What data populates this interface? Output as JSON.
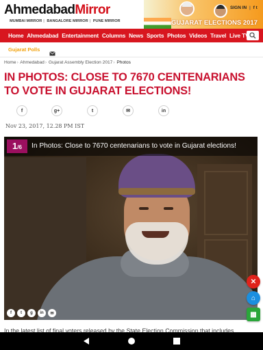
{
  "header": {
    "logo_part1": "Ahmedabad",
    "logo_part2": "Mirror",
    "sister_links": [
      "MUMBAI MIRROR",
      "BANGALORE MIRROR",
      "PUNE MIRROR"
    ],
    "banner_title": "GUJARAT ELECTIONS 2017",
    "signin_label": "SIGN IN",
    "social_label": "f t",
    "colors": {
      "brand_red": "#d8161f",
      "logo_red": "#d4111b",
      "headline_red": "#c8102e",
      "subnav_orange": "#f2a20c"
    }
  },
  "nav": {
    "items": [
      "Home",
      "Ahmedabad",
      "Entertainment",
      "Columns",
      "News",
      "Sports",
      "Photos",
      "Videos",
      "Travel",
      "Live TV"
    ],
    "search_icon": "search-icon"
  },
  "subnav": {
    "item": "Gujarat Polls",
    "mail_icon": "mail-icon"
  },
  "breadcrumb": {
    "items": [
      "Home",
      "Ahmedabad",
      "Gujarat Assembly Election 2017",
      "Photos"
    ]
  },
  "article": {
    "headline": "IN PHOTOS: CLOSE TO 7670 CENTENARIANS TO VOTE IN GUJARAT ELECTIONS!",
    "date": "Nov 23, 2017, 12.28 PM IST",
    "share_icons": [
      "facebook-icon",
      "google-plus-icon",
      "twitter-icon",
      "email-icon",
      "linkedin-icon"
    ],
    "share_glyphs": [
      "f",
      "g+",
      "t",
      "✉",
      "in"
    ],
    "gallery": {
      "counter_current": "1",
      "counter_total": "6",
      "caption": "In Photos: Close to 7670 centenarians to vote in Gujarat elections!",
      "share_glyphs": [
        "f",
        "t",
        "g",
        "in",
        "✉"
      ]
    },
    "body_text": "In the latest list of final voters released by the State Election Commission that includes"
  },
  "floating": {
    "close_glyph": "✕",
    "home_glyph": "⌂",
    "grid_glyph": "▦"
  }
}
